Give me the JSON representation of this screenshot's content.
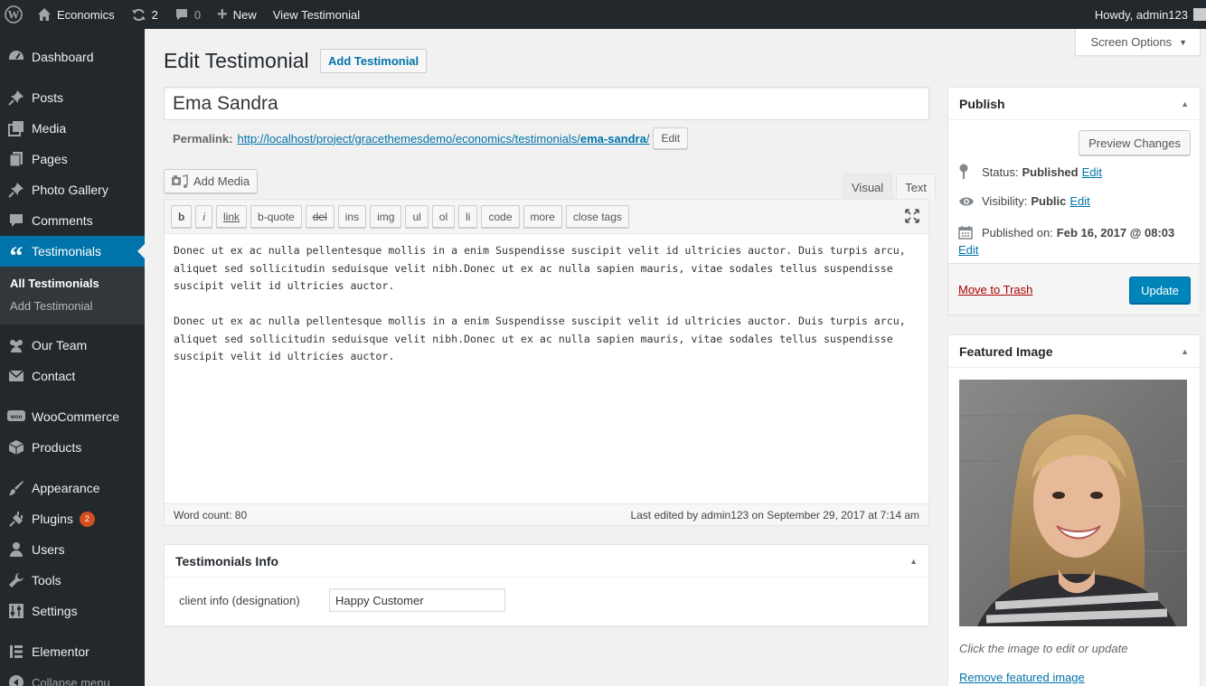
{
  "adminbar": {
    "site_name": "Economics",
    "updates_count": "2",
    "comments_count": "0",
    "new_label": "New",
    "view_label": "View Testimonial",
    "howdy": "Howdy, admin123"
  },
  "sidebar": {
    "items": [
      {
        "label": "Dashboard",
        "icon": "dashboard-icon"
      },
      {
        "label": "Posts",
        "icon": "pin-icon"
      },
      {
        "label": "Media",
        "icon": "media-icon"
      },
      {
        "label": "Pages",
        "icon": "pages-icon"
      },
      {
        "label": "Photo Gallery",
        "icon": "pin-icon"
      },
      {
        "label": "Comments",
        "icon": "comments-icon"
      },
      {
        "label": "Testimonials",
        "icon": "quote-icon"
      },
      {
        "label": "Our Team",
        "icon": "team-icon"
      },
      {
        "label": "Contact",
        "icon": "mail-icon"
      },
      {
        "label": "WooCommerce",
        "icon": "woocommerce-icon"
      },
      {
        "label": "Products",
        "icon": "box-icon"
      },
      {
        "label": "Appearance",
        "icon": "brush-icon"
      },
      {
        "label": "Plugins",
        "icon": "plug-icon"
      },
      {
        "label": "Users",
        "icon": "user-icon"
      },
      {
        "label": "Tools",
        "icon": "wrench-icon"
      },
      {
        "label": "Settings",
        "icon": "settings-icon"
      },
      {
        "label": "Elementor",
        "icon": "elementor-icon"
      }
    ],
    "submenu": [
      "All Testimonials",
      "Add Testimonial"
    ],
    "plugins_badge": "2",
    "collapse_label": "Collapse menu"
  },
  "screen_options": "Screen Options",
  "page": {
    "title": "Edit Testimonial",
    "add_new": "Add Testimonial",
    "post_title": "Ema Sandra",
    "permalink_label": "Permalink:",
    "permalink_base": "http://localhost/project/gracethemesdemo/economics/testimonials/",
    "permalink_slug": "ema-sandra",
    "permalink_trail": "/",
    "edit_btn": "Edit"
  },
  "editor": {
    "add_media": "Add Media",
    "tab_visual": "Visual",
    "tab_text": "Text",
    "qt_buttons": [
      "b",
      "i",
      "link",
      "b-quote",
      "del",
      "ins",
      "img",
      "ul",
      "ol",
      "li",
      "code",
      "more",
      "close tags"
    ],
    "paragraphs": [
      "Donec ut ex ac nulla pellentesque mollis in a enim Suspendisse suscipit velit id ultricies auctor. Duis turpis arcu, aliquet sed sollicitudin seduisque velit nibh.Donec ut ex ac nulla sapien mauris, vitae sodales tellus suspendisse suscipit velit id ultricies auctor.",
      "Donec ut ex ac nulla pellentesque mollis in a enim Suspendisse suscipit velit id ultricies auctor. Duis turpis arcu, aliquet sed sollicitudin seduisque velit nibh.Donec ut ex ac nulla sapien mauris, vitae sodales tellus suspendisse suscipit velit id ultricies auctor."
    ],
    "word_count": "Word count: 80",
    "last_edited": "Last edited by admin123 on September 29, 2017 at 7:14 am"
  },
  "testimonials_info": {
    "title": "Testimonials Info",
    "field_label": "client info (designation)",
    "field_value": "Happy Customer"
  },
  "publish": {
    "title": "Publish",
    "preview": "Preview Changes",
    "status_label": "Status:",
    "status_value": "Published",
    "visibility_label": "Visibility:",
    "visibility_value": "Public",
    "published_label": "Published on:",
    "published_value": "Feb 16, 2017 @ 08:03",
    "edit_link": "Edit",
    "trash": "Move to Trash",
    "update": "Update"
  },
  "featured": {
    "title": "Featured Image",
    "caption": "Click the image to edit or update",
    "remove": "Remove featured image"
  },
  "colors": {
    "adminbar": "#23282d",
    "accent": "#0073aa",
    "primary_button": "#0085ba",
    "badge": "#d54e21"
  }
}
